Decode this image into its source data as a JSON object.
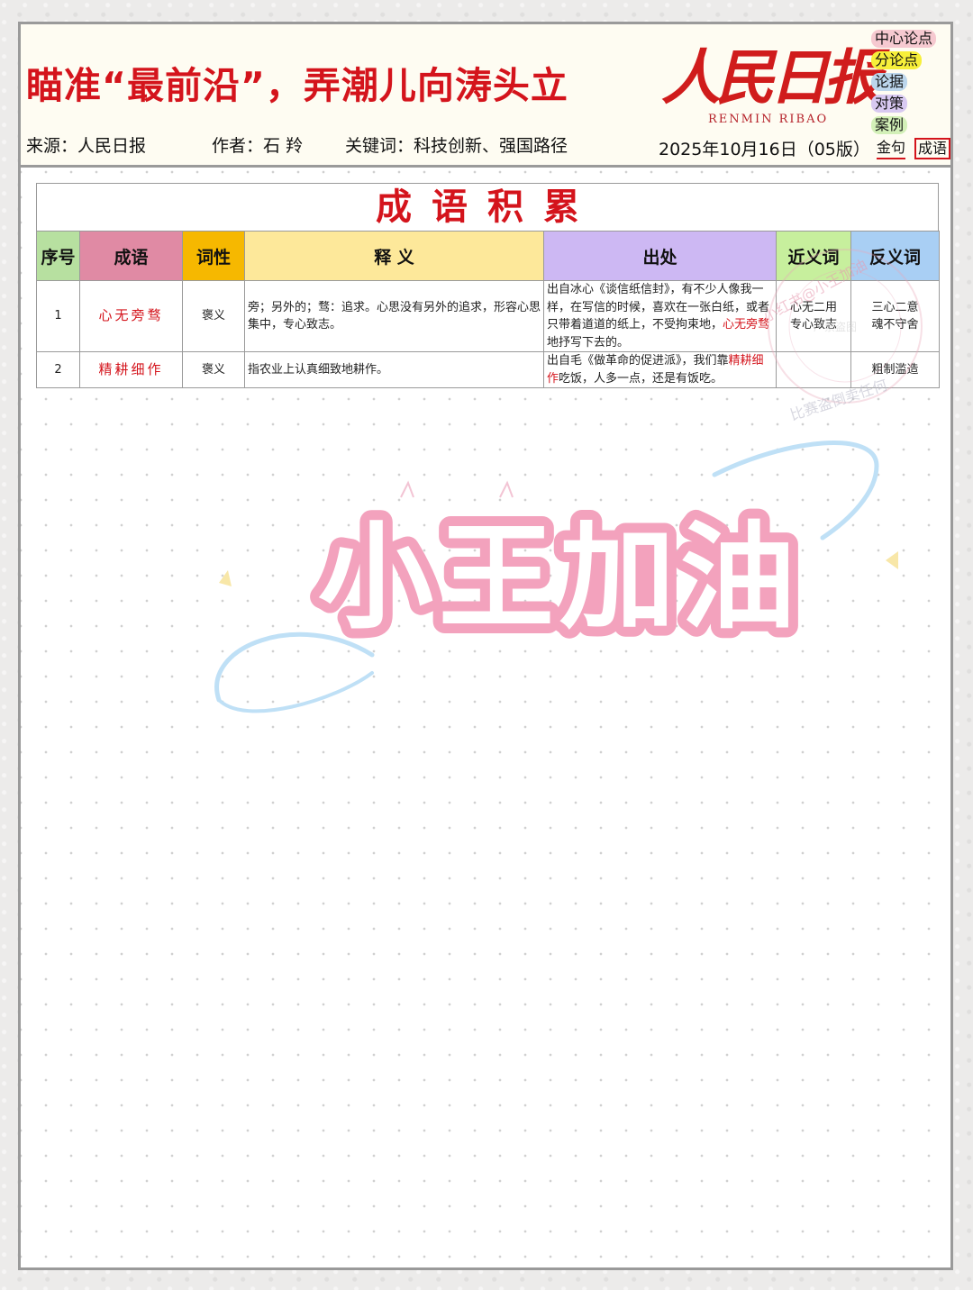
{
  "header": {
    "title": "瞄准“最前沿”，弄潮儿向涛头立",
    "source": "来源：人民日报",
    "author": "作者：石 羚",
    "keywords": "关键词：科技创新、强国路径",
    "date": "2025年10月16日（05版）",
    "logo_main": "人民日报",
    "logo_sub": "RENMIN RIBAO"
  },
  "tags": {
    "center": "中心论点",
    "sub_points": "分论点",
    "evidence": "论据",
    "measures": "对策",
    "cases": "案例",
    "golden": "金句",
    "idioms": "成语"
  },
  "table": {
    "title": "成语积累",
    "headers": {
      "no": "序号",
      "idiom": "成语",
      "pos": "词性",
      "meaning": "释 义",
      "source": "出处",
      "synonym": "近义词",
      "antonym": "反义词"
    },
    "rows": [
      {
        "no": "1",
        "idiom": "心无旁骛",
        "pos": "褒义",
        "meaning": "旁；另外的；骛：追求。心思没有另外的追求，形容心思集中，专心致志。",
        "source_pre": "出自冰心《谈信纸信封》，有不少人像我一样，在写信的时候，喜欢在一张白纸，或者只带着道道的纸上，不受拘束地，",
        "source_hl": "心无旁骛",
        "source_post": "地抒写下去的。",
        "synonym_1": "心无二用",
        "synonym_2": "专心致志",
        "antonym_1": "三心二意",
        "antonym_2": "魂不守舍"
      },
      {
        "no": "2",
        "idiom": "精耕细作",
        "pos": "褒义",
        "meaning": "指农业上认真细致地耕作。",
        "source_pre": "出自毛《做革命的促进派》，我们靠",
        "source_hl": "精耕细作",
        "source_post": "吃饭，人多一点，还是有饭吃。",
        "synonym_1": "",
        "synonym_2": "",
        "antonym_1": "粗制滥造",
        "antonym_2": ""
      }
    ]
  },
  "watermark": {
    "line1": "小红书@小王加油",
    "line2": "严禁盗图",
    "line3": "比赛盗倒卖任何"
  },
  "cheer_text": "小王加油",
  "colors": {
    "accent_red": "#d4141c",
    "th_no": "#b7e0a0",
    "th_idiom": "#e08aa4",
    "th_pos": "#f6b800",
    "th_meaning": "#fde89a",
    "th_source": "#cdb8f3",
    "th_synonym": "#c7ef9d",
    "th_antonym": "#a9cff4"
  }
}
